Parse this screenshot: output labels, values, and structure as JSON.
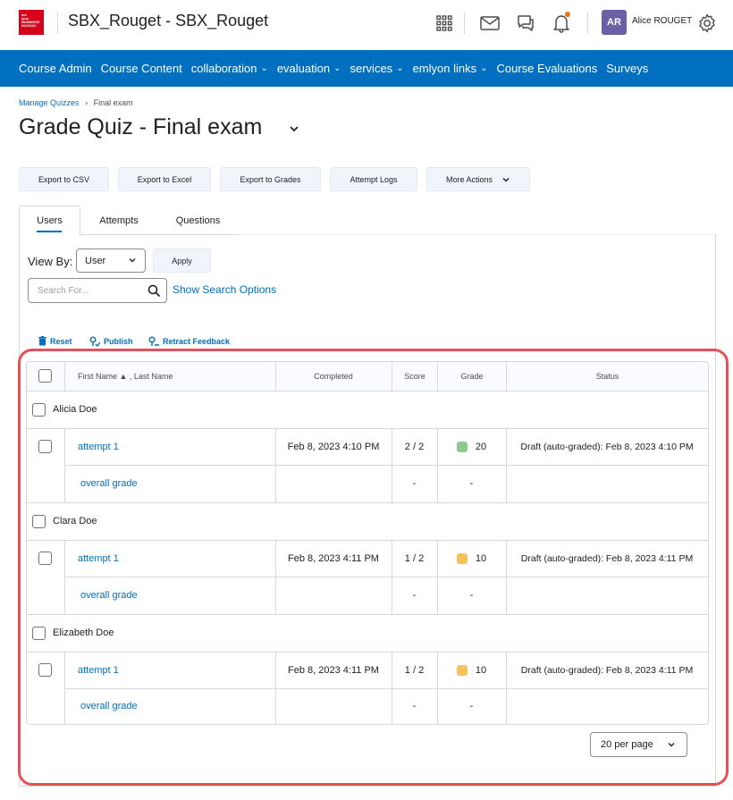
{
  "header": {
    "logo_text": [
      "em",
      "lyon",
      "BUSINESS",
      "SCHOOL"
    ],
    "course_title": "SBX_Rouget - SBX_Rouget",
    "user_initials": "AR",
    "user_name": "Alice ROUGET",
    "notification_dot_color": "#e87511",
    "icons": [
      "grid-apps-icon",
      "mail-icon",
      "chat-icon",
      "bell-icon",
      "gear-icon"
    ]
  },
  "nav": {
    "items": [
      {
        "label": "Course Admin",
        "dropdown": false
      },
      {
        "label": "Course Content",
        "dropdown": false
      },
      {
        "label": "collaboration",
        "dropdown": true
      },
      {
        "label": "evaluation",
        "dropdown": true
      },
      {
        "label": "services",
        "dropdown": true
      },
      {
        "label": "emlyon links",
        "dropdown": true
      },
      {
        "label": "Course Evaluations",
        "dropdown": false
      },
      {
        "label": "Surveys",
        "dropdown": false
      }
    ]
  },
  "breadcrumb": {
    "parent": "Manage Quizzes",
    "separator": "›",
    "current": "Final exam"
  },
  "page_title": "Grade Quiz - Final exam",
  "actions": {
    "export_csv": "Export to CSV",
    "export_excel": "Export to Excel",
    "export_grades": "Export to Grades",
    "attempt_logs": "Attempt Logs",
    "more_actions": "More Actions"
  },
  "tabs": [
    {
      "label": "Users",
      "active": true
    },
    {
      "label": "Attempts",
      "active": false
    },
    {
      "label": "Questions",
      "active": false
    }
  ],
  "filters": {
    "view_by_label": "View By:",
    "view_by_value": "User",
    "apply_label": "Apply",
    "search_placeholder": "Search For...",
    "search_options_label": "Show Search Options"
  },
  "tools": {
    "reset": "Reset",
    "publish": "Publish",
    "retract": "Retract Feedback"
  },
  "table": {
    "headers": {
      "name": "First Name ▲ , Last Name",
      "completed": "Completed",
      "score": "Score",
      "grade": "Grade",
      "status": "Status"
    },
    "users": [
      {
        "name": "Alicia Doe",
        "attempt_label": "attempt 1",
        "completed": "Feb 8, 2023 4:10 PM",
        "score": "2 / 2",
        "grade": "20",
        "grade_color": "#8ec98f",
        "status": "Draft (auto-graded): Feb 8, 2023 4:10 PM",
        "overall_label": "overall grade",
        "overall_score": "-",
        "overall_grade": "-"
      },
      {
        "name": "Clara Doe",
        "attempt_label": "attempt 1",
        "completed": "Feb 8, 2023 4:11 PM",
        "score": "1 / 2",
        "grade": "10",
        "grade_color": "#f4c15a",
        "status": "Draft (auto-graded): Feb 8, 2023 4:11 PM",
        "overall_label": "overall grade",
        "overall_score": "-",
        "overall_grade": "-"
      },
      {
        "name": "Elizabeth Doe",
        "attempt_label": "attempt 1",
        "completed": "Feb 8, 2023 4:11 PM",
        "score": "1 / 2",
        "grade": "10",
        "grade_color": "#f4c15a",
        "status": "Draft (auto-graded): Feb 8, 2023 4:11 PM",
        "overall_label": "overall grade",
        "overall_score": "-",
        "overall_grade": "-"
      }
    ]
  },
  "pagination": {
    "per_page": "20 per page"
  },
  "colors": {
    "brand": "#006fbf",
    "highlight": "#e3525a",
    "logo": "#d6001c"
  }
}
